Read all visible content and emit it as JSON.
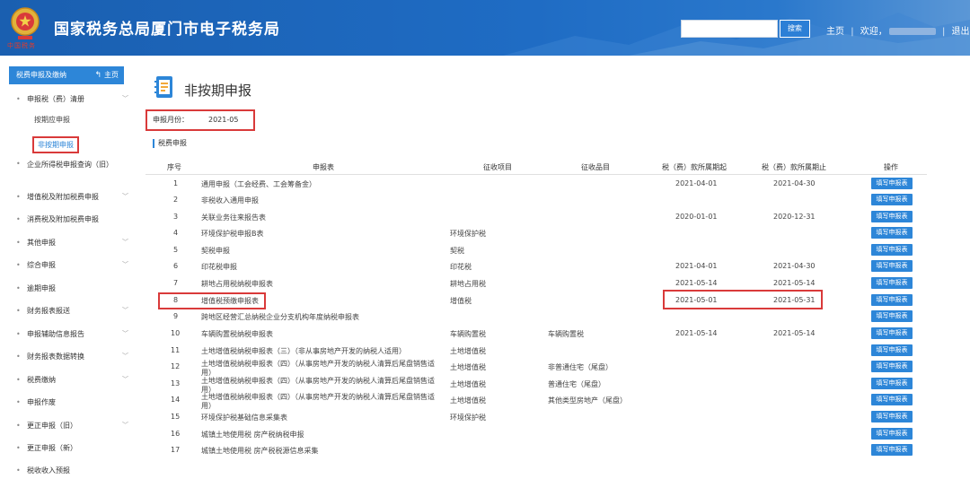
{
  "header": {
    "site_title": "国家税务总局厦门市电子税务局",
    "emblem_caption": "中国税务",
    "search_placeholder": "",
    "search_button": "搜索",
    "home_link": "主页",
    "welcome_text": "欢迎，",
    "logout_link": "退出",
    "separator": "|",
    "brand_color": "#1f6cc4"
  },
  "sidebar": {
    "header_label": "税费申报及缴纳",
    "home_label": "主页",
    "items": [
      {
        "label": "申报税（费）清册",
        "expand": true
      },
      {
        "label": "企业所得税申报查询（旧）",
        "expand": false
      },
      {
        "label": "增值税及附加税费申报",
        "expand": true
      },
      {
        "label": "消费税及附加税费申报",
        "expand": false
      },
      {
        "label": "其他申报",
        "expand": true
      },
      {
        "label": "综合申报",
        "expand": true
      },
      {
        "label": "逾期申报",
        "expand": false
      },
      {
        "label": "财务报表报送",
        "expand": true
      },
      {
        "label": "申报辅助信息报告",
        "expand": true
      },
      {
        "label": "财务报表数据转换",
        "expand": true
      },
      {
        "label": "税费缴纳",
        "expand": true
      },
      {
        "label": "申报作废",
        "expand": false
      },
      {
        "label": "更正申报（旧）",
        "expand": true
      },
      {
        "label": "更正申报（新）",
        "expand": false
      },
      {
        "label": "税收收入预报",
        "expand": false
      }
    ],
    "subitems": [
      {
        "label": "按期应申报",
        "active": false
      },
      {
        "label": "非按期申报",
        "active": true
      }
    ]
  },
  "main": {
    "page_title": "非按期申报",
    "period_label": "申报月份：",
    "period_value": "2021-05",
    "section_title": "税费申报",
    "columns": [
      "序号",
      "申报表",
      "征收项目",
      "征收品目",
      "税（费）款所属期起",
      "税（费）款所属期止",
      "操作"
    ],
    "button_label": "填写申报表",
    "rows": [
      {
        "no": "1",
        "form": "通用申报（工会经费、工会筹备金）",
        "item": "",
        "subitem": "",
        "start": "2021-04-01",
        "end": "2021-04-30"
      },
      {
        "no": "2",
        "form": "非税收入通用申报",
        "item": "",
        "subitem": "",
        "start": "",
        "end": ""
      },
      {
        "no": "3",
        "form": "关联业务往来报告表",
        "item": "",
        "subitem": "",
        "start": "2020-01-01",
        "end": "2020-12-31"
      },
      {
        "no": "4",
        "form": "环境保护税申报B表",
        "item": "环境保护税",
        "subitem": "",
        "start": "",
        "end": ""
      },
      {
        "no": "5",
        "form": "契税申报",
        "item": "契税",
        "subitem": "",
        "start": "",
        "end": ""
      },
      {
        "no": "6",
        "form": "印花税申报",
        "item": "印花税",
        "subitem": "",
        "start": "2021-04-01",
        "end": "2021-04-30"
      },
      {
        "no": "7",
        "form": "耕地占用税纳税申报表",
        "item": "耕地占用税",
        "subitem": "",
        "start": "2021-05-14",
        "end": "2021-05-14"
      },
      {
        "no": "8",
        "form": "增值税预缴申报表",
        "item": "增值税",
        "subitem": "",
        "start": "2021-05-01",
        "end": "2021-05-31"
      },
      {
        "no": "9",
        "form": "跨地区经营汇总纳税企业分支机构年度纳税申报表",
        "item": "",
        "subitem": "",
        "start": "",
        "end": ""
      },
      {
        "no": "10",
        "form": "车辆购置税纳税申报表",
        "item": "车辆购置税",
        "subitem": "车辆购置税",
        "start": "2021-05-14",
        "end": "2021-05-14"
      },
      {
        "no": "11",
        "form": "土地增值税纳税申报表（三）（非从事房地产开发的纳税人适用）",
        "item": "土地增值税",
        "subitem": "",
        "start": "",
        "end": ""
      },
      {
        "no": "12",
        "form": "土地增值税纳税申报表（四）（从事房地产开发的纳税人清算后尾盘销售适用）",
        "item": "土地增值税",
        "subitem": "非普通住宅（尾盘）",
        "start": "",
        "end": ""
      },
      {
        "no": "13",
        "form": "土地增值税纳税申报表（四）（从事房地产开发的纳税人清算后尾盘销售适用）",
        "item": "土地增值税",
        "subitem": "普通住宅（尾盘）",
        "start": "",
        "end": ""
      },
      {
        "no": "14",
        "form": "土地增值税纳税申报表（四）（从事房地产开发的纳税人清算后尾盘销售适用）",
        "item": "土地增值税",
        "subitem": "其他类型房地产（尾盘）",
        "start": "",
        "end": ""
      },
      {
        "no": "15",
        "form": "环境保护税基础信息采集表",
        "item": "环境保护税",
        "subitem": "",
        "start": "",
        "end": ""
      },
      {
        "no": "16",
        "form": "城镇土地使用税 房产税纳税申报",
        "item": "",
        "subitem": "",
        "start": "",
        "end": ""
      },
      {
        "no": "17",
        "form": "城镇土地使用税 房产税税源信息采集",
        "item": "",
        "subitem": "",
        "start": "",
        "end": ""
      }
    ]
  }
}
